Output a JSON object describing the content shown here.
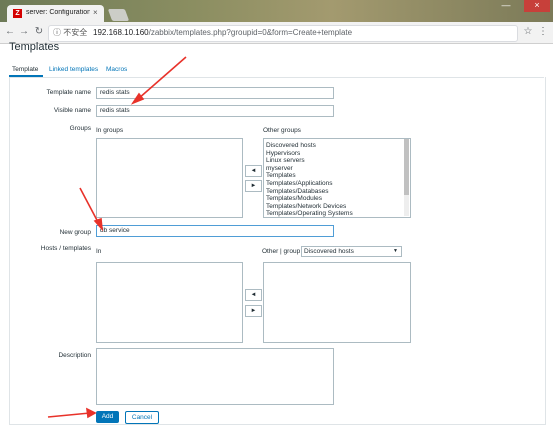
{
  "browser": {
    "tab_title": "server: Configuration o",
    "tab_close": "×",
    "window_buttons": [
      "—",
      "×"
    ],
    "security_label": "ⓘ 不安全",
    "url_host": "192.168.10.160",
    "url_path": "/zabbix/templates.php?groupid=0&form=Create+template"
  },
  "page": {
    "title": "Templates",
    "tabs": [
      "Template",
      "Linked templates",
      "Macros"
    ]
  },
  "form": {
    "template_name_label": "Template name",
    "template_name_value": "redis stats",
    "visible_name_label": "Visible name",
    "visible_name_value": "redis stats",
    "groups_label": "Groups",
    "in_groups_label": "In groups",
    "other_groups_label": "Other groups",
    "other_groups": [
      "Discovered hosts",
      "Hypervisors",
      "Linux servers",
      "myserver",
      "Templates",
      "Templates/Applications",
      "Templates/Databases",
      "Templates/Modules",
      "Templates/Network Devices",
      "Templates/Operating Systems"
    ],
    "move_left": "◄",
    "move_right": "►",
    "new_group_label": "New group",
    "new_group_value": "db service",
    "hosts_templates_label": "Hosts / templates",
    "in_label": "In",
    "other_group_label": "Other | group",
    "group_select_value": "Discovered hosts",
    "description_label": "Description",
    "add_button": "Add",
    "cancel_button": "Cancel"
  },
  "colors": {
    "accent": "#0275b8",
    "annotation_arrow": "#e8322a"
  }
}
